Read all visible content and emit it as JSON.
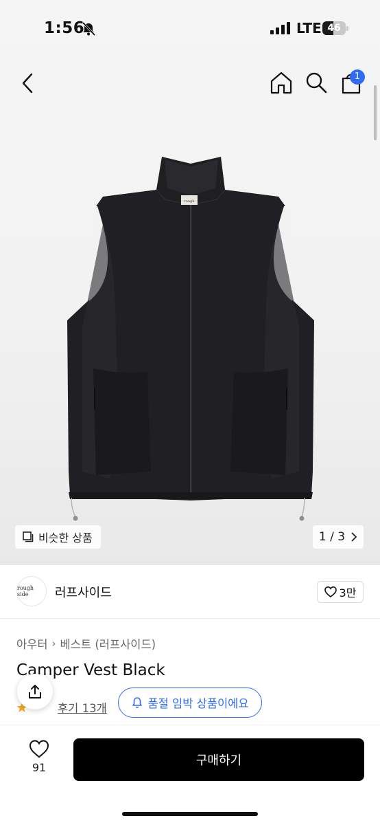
{
  "status_bar": {
    "time": "1:56",
    "network": "LTE",
    "battery": "46",
    "battery_level": 0.46
  },
  "nav": {
    "cart_count": "1"
  },
  "hero": {
    "similar_label": "비슷한 상품",
    "page_counter": "1 / 3",
    "garment_tag": "rough"
  },
  "seller": {
    "avatar_text": "rough side",
    "name": "러프사이드",
    "likes": "3만"
  },
  "product": {
    "breadcrumb": [
      "아우터",
      "베스트 (러프사이드)"
    ],
    "title": "Camper Vest Black",
    "review_label": "후기 13개",
    "stock_notice": "품절 임박 상품이에요"
  },
  "bottom_bar": {
    "wish_count": "91",
    "buy_label": "구매하기"
  },
  "colors": {
    "accent": "#2f6cf6",
    "buy_button": "#000000",
    "star": "#f5a623"
  },
  "icons": [
    "bell-slash-icon",
    "signal-icon",
    "battery-icon",
    "back-icon",
    "home-icon",
    "search-icon",
    "cart-icon",
    "similar-icon",
    "chevron-right-icon",
    "heart-icon",
    "share-icon",
    "star-icon",
    "bell-icon"
  ]
}
